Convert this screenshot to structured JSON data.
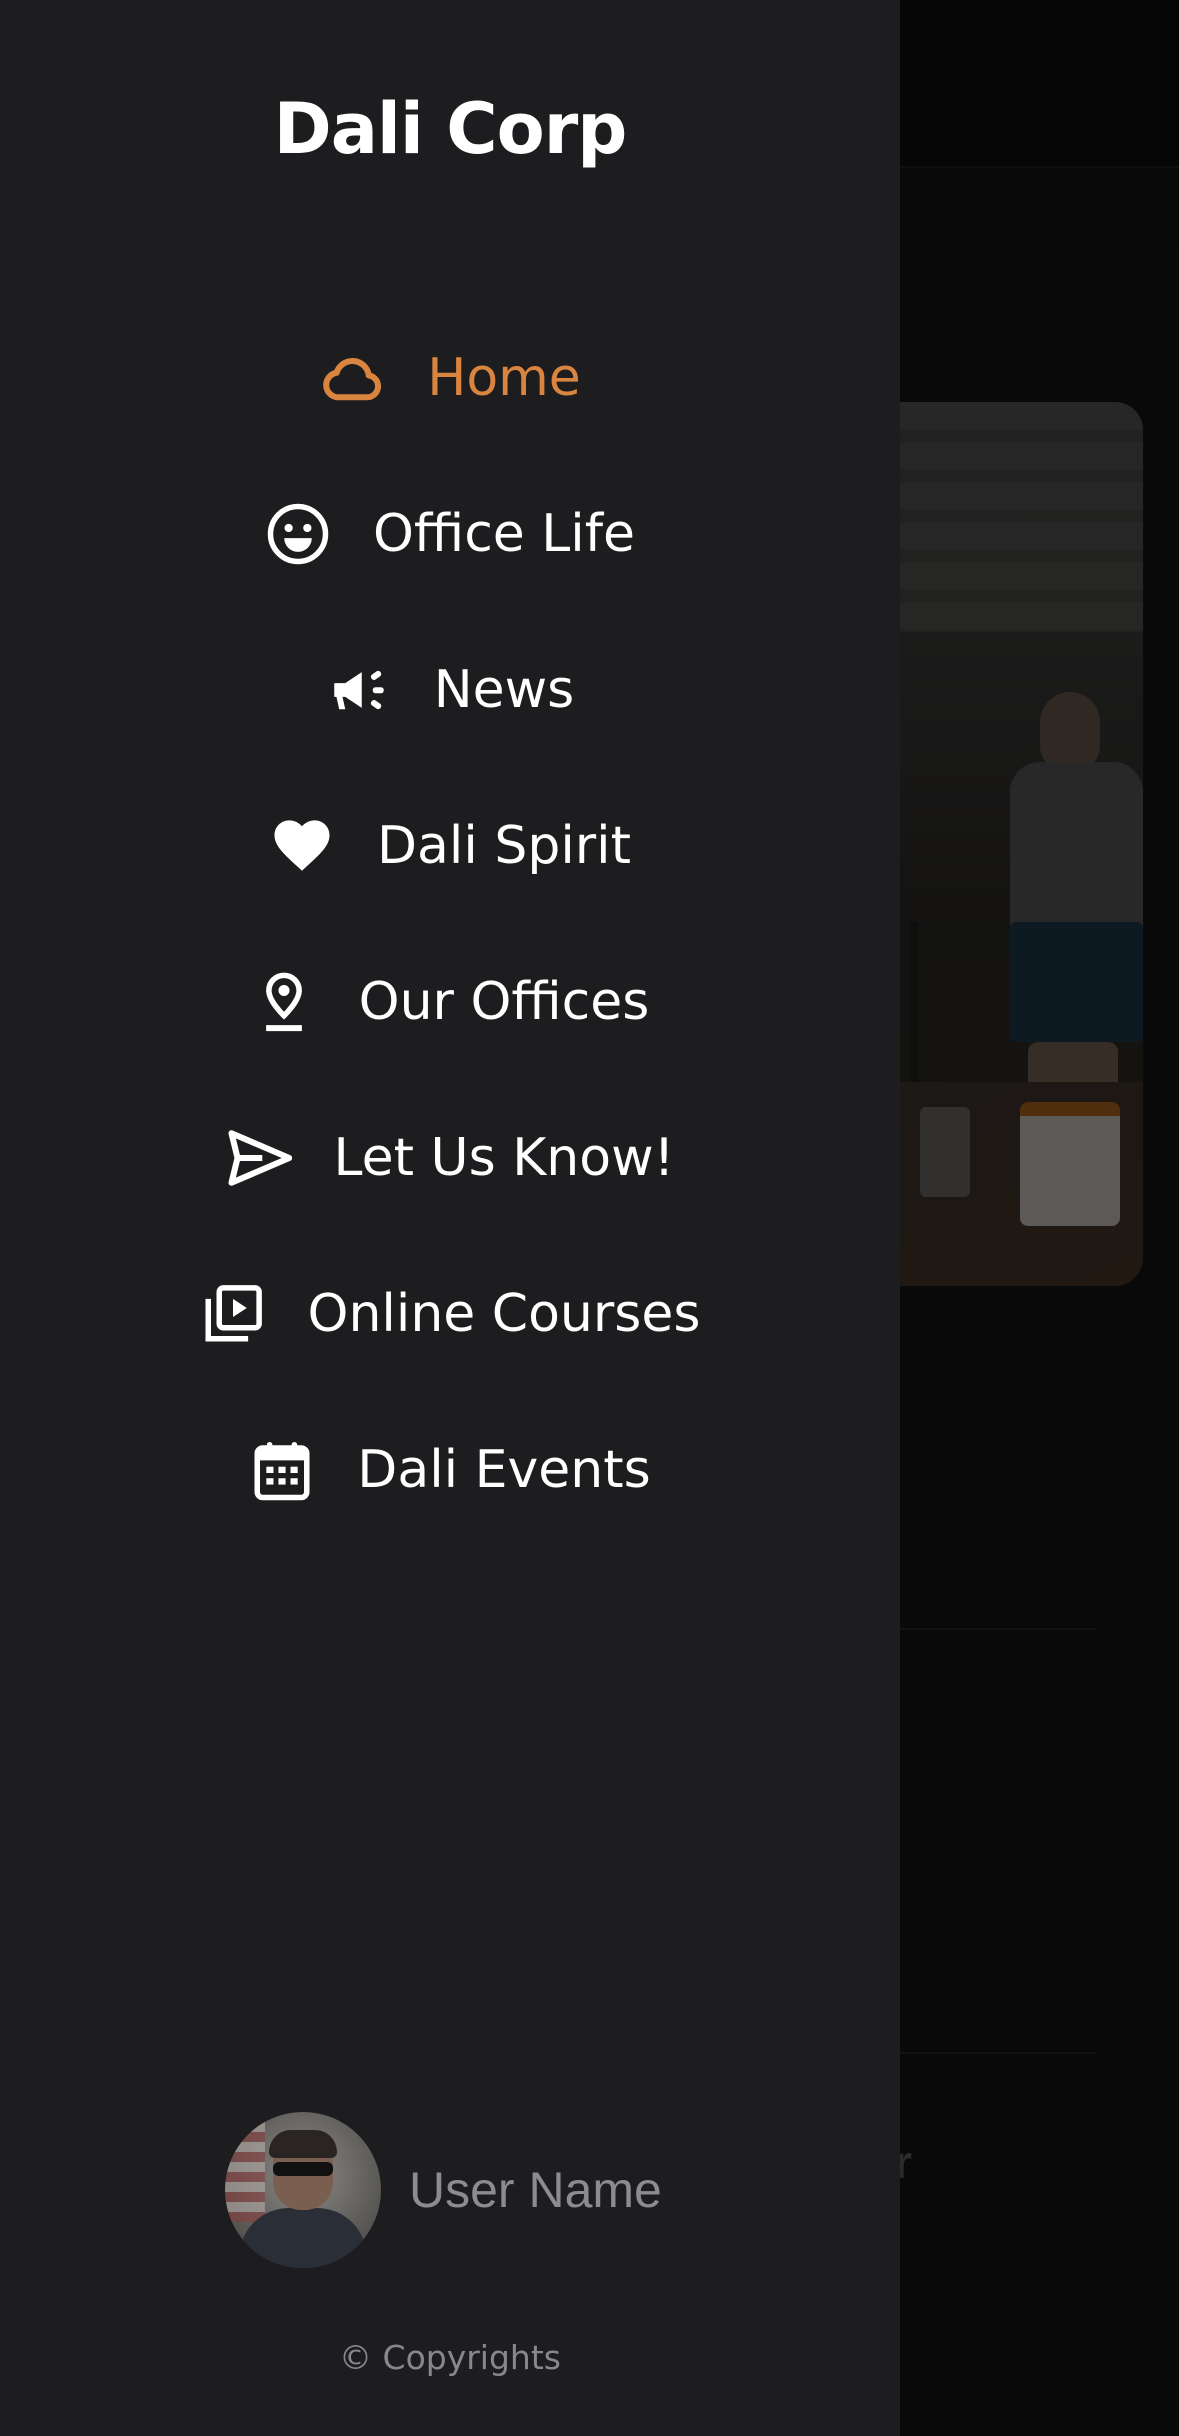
{
  "drawer": {
    "title": "Dali Corp",
    "menu": [
      {
        "label": "Home",
        "icon": "cloud-icon",
        "active": true
      },
      {
        "label": "Office Life",
        "icon": "smiley-icon",
        "active": false
      },
      {
        "label": "News",
        "icon": "megaphone-icon",
        "active": false
      },
      {
        "label": "Dali Spirit",
        "icon": "heart-icon",
        "active": false
      },
      {
        "label": "Our Offices",
        "icon": "map-pin-icon",
        "active": false
      },
      {
        "label": "Let Us Know!",
        "icon": "send-icon",
        "active": false
      },
      {
        "label": "Online Courses",
        "icon": "video-library-icon",
        "active": false
      },
      {
        "label": "Dali Events",
        "icon": "calendar-icon",
        "active": false
      }
    ],
    "user": {
      "name": "User Name"
    },
    "copyright": "© Copyrights"
  },
  "background": {
    "partial_text": "ur"
  },
  "colors": {
    "drawer_bg": "#1d1d1f",
    "accent": "#d9843f",
    "text": "#ffffff",
    "muted": "#8c8c90"
  }
}
